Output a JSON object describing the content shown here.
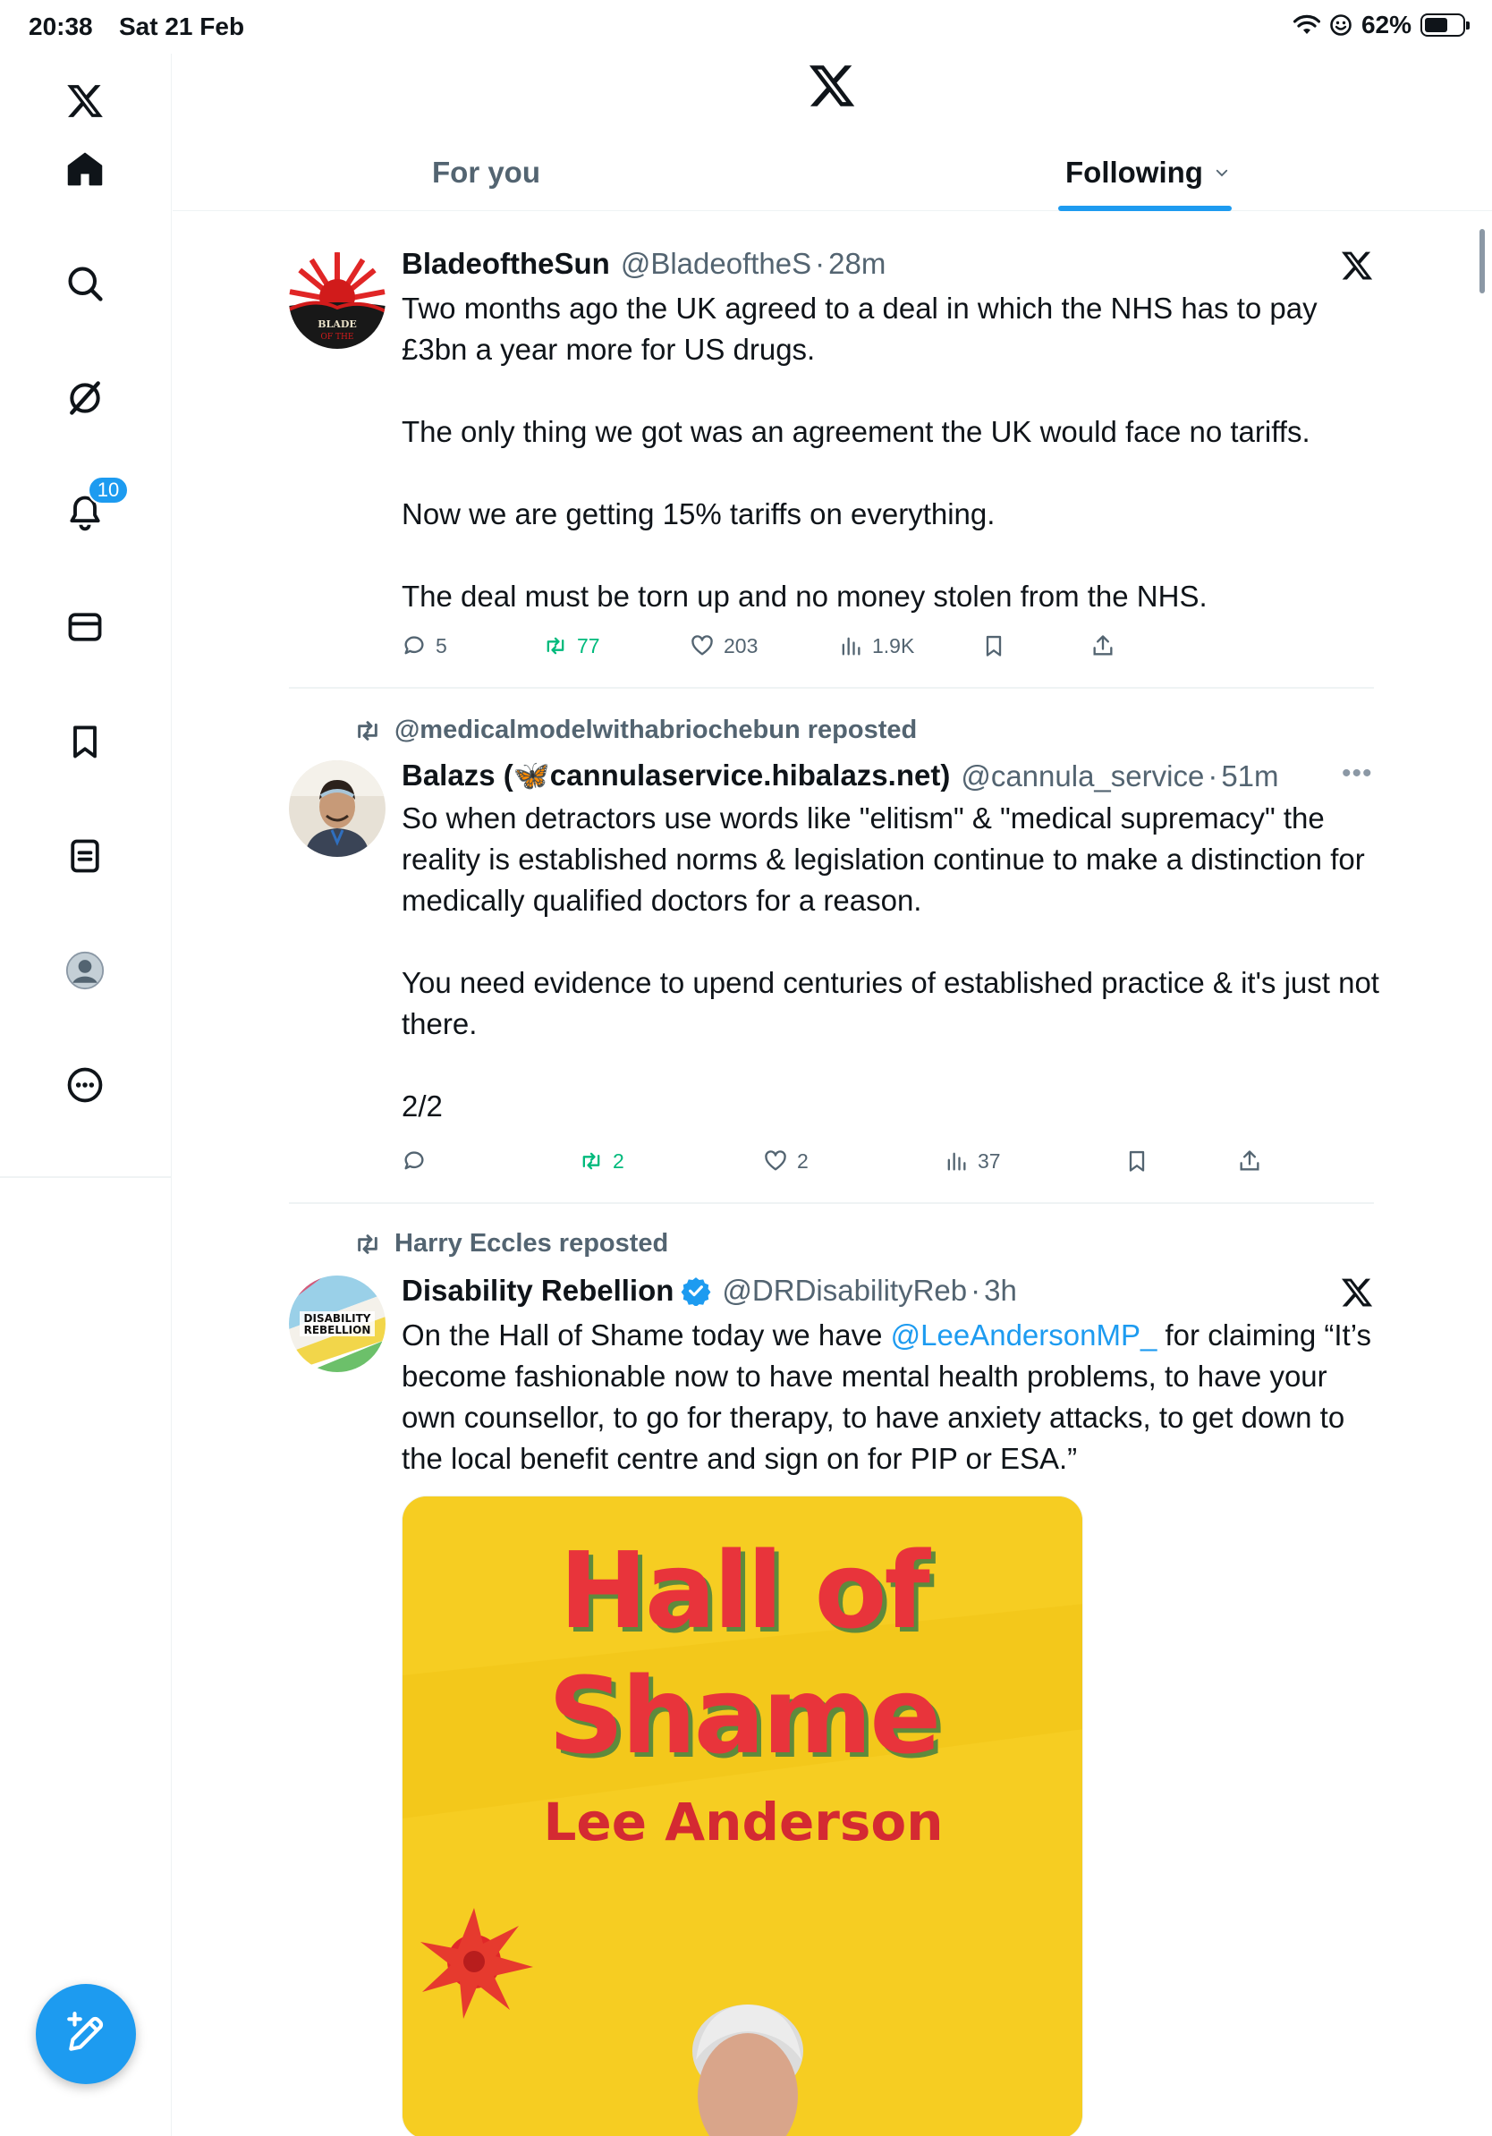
{
  "status_bar": {
    "time": "20:38",
    "date": "Sat 21 Feb",
    "battery": "62%",
    "battery_level": 0.62
  },
  "sidebar": {
    "items": [
      {
        "name": "x-logo",
        "icon": "x-logo-icon"
      },
      {
        "name": "home",
        "icon": "home-icon"
      },
      {
        "name": "search",
        "icon": "search-icon"
      },
      {
        "name": "grok",
        "icon": "grok-icon"
      },
      {
        "name": "notifications",
        "icon": "bell-icon",
        "badge": "10"
      },
      {
        "name": "messages",
        "icon": "envelope-icon"
      },
      {
        "name": "bookmarks",
        "icon": "bookmark-icon"
      },
      {
        "name": "lists",
        "icon": "list-icon"
      },
      {
        "name": "profile",
        "icon": "avatar-icon"
      },
      {
        "name": "more",
        "icon": "more-circle-icon"
      }
    ],
    "compose_icon": "compose-icon"
  },
  "header": {
    "tabs": [
      {
        "label": "For you",
        "active": false
      },
      {
        "label": "Following",
        "active": true
      }
    ]
  },
  "colors": {
    "accent": "#1d9bf0",
    "text": "#0f1419",
    "secondary": "#536471",
    "repost_active": "#00ba7c"
  },
  "posts": [
    {
      "author": "BladeoftheSun",
      "handle": "@BladeoftheS",
      "time": "28m",
      "paragraphs": [
        "Two months ago the UK agreed to a deal in which the NHS has to pay £3bn a year more for US drugs.",
        "The only thing we got was an agreement the UK would face no tariffs.",
        "Now we are getting 15% tariffs on everything.",
        "The deal must be torn up and no money stolen from the NHS."
      ],
      "stats": {
        "replies": "5",
        "reposts": "77",
        "likes": "203",
        "views": "1.9K"
      }
    },
    {
      "repost_by": "@medicalmodelwithabriochebun reposted",
      "author": "Balazs (🦋cannulaservice.hibalazs.net)",
      "handle": "@cannula_service",
      "time": "51m",
      "paragraphs": [
        "So when detractors use words like \"elitism\" & \"medical supremacy\" the reality is established norms & legislation continue to make a distinction for medically qualified doctors for a reason.",
        "You need evidence to upend centuries of established practice & it's just not there.",
        "2/2"
      ],
      "stats": {
        "replies": "",
        "reposts": "2",
        "likes": "2",
        "views": "37"
      }
    },
    {
      "repost_by": "Harry Eccles reposted",
      "author": "Disability Rebellion",
      "verified": true,
      "handle": "@DRDisabilityReb",
      "time": "3h",
      "text_before": "On the Hall of Shame today we have ",
      "mention": "@LeeAndersonMP_",
      "text_after": " for claiming “It’s become fashionable now to have mental health problems, to have your own counsellor, to go for therapy, to have anxiety attacks, to get down to the local benefit centre and sign on for PIP or ESA.”",
      "media": {
        "line1": "Hall of",
        "line2": "Shame",
        "line3": "Lee Anderson"
      }
    }
  ]
}
